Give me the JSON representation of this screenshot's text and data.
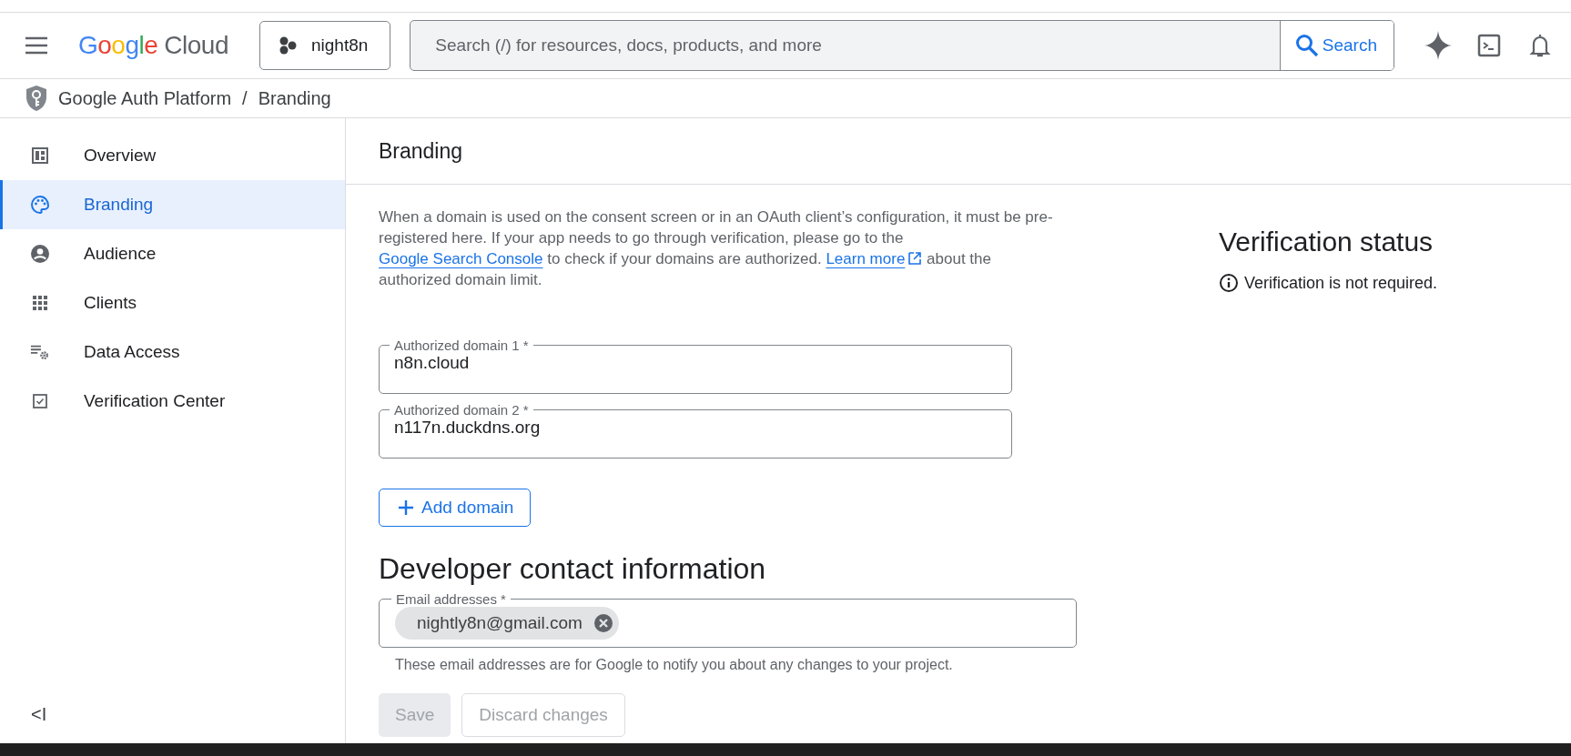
{
  "header": {
    "logo": {
      "google": "Google",
      "cloud": "Cloud"
    },
    "project": "night8n",
    "search": {
      "placeholder": "Search (/) for resources, docs, products, and more",
      "button": "Search"
    }
  },
  "breadcrumb": {
    "items": [
      "Google Auth Platform",
      "Branding"
    ],
    "separator": "/"
  },
  "sidebar": {
    "items": [
      {
        "label": "Overview",
        "selected": false
      },
      {
        "label": "Branding",
        "selected": true
      },
      {
        "label": "Audience",
        "selected": false
      },
      {
        "label": "Clients",
        "selected": false
      },
      {
        "label": "Data Access",
        "selected": false
      },
      {
        "label": "Verification Center",
        "selected": false
      }
    ],
    "collapse": "<I"
  },
  "page_title": "Branding",
  "domains": {
    "description": [
      {
        "kind": "text",
        "text": "When a domain is used on the consent screen or in an OAuth client’s configuration, it must be pre-registered here. If your app needs to go through verification, please go to the "
      },
      {
        "kind": "link",
        "text": "Google Search Console"
      },
      {
        "kind": "text",
        "text": " to check if your domains are authorized. "
      },
      {
        "kind": "external_link",
        "text": "Learn more"
      },
      {
        "kind": "text",
        "text": " about the authorized domain limit."
      }
    ],
    "fields": [
      {
        "label": "Authorized domain 1 *",
        "value": "n8n.cloud"
      },
      {
        "label": "Authorized domain 2 *",
        "value": "n117n.duckdns.org"
      }
    ],
    "add_button": "Add domain"
  },
  "developer_contact": {
    "heading": "Developer contact information",
    "field_label": "Email addresses *",
    "chips": [
      "nightly8n@gmail.com"
    ],
    "helper": "These email addresses are for Google to notify you about any changes to your project."
  },
  "actions": [
    {
      "label": "Save",
      "kind": "filled",
      "disabled": true
    },
    {
      "label": "Discard changes",
      "kind": "outlined",
      "disabled": true
    }
  ],
  "verification": {
    "title": "Verification status",
    "message": "Verification is not required."
  }
}
